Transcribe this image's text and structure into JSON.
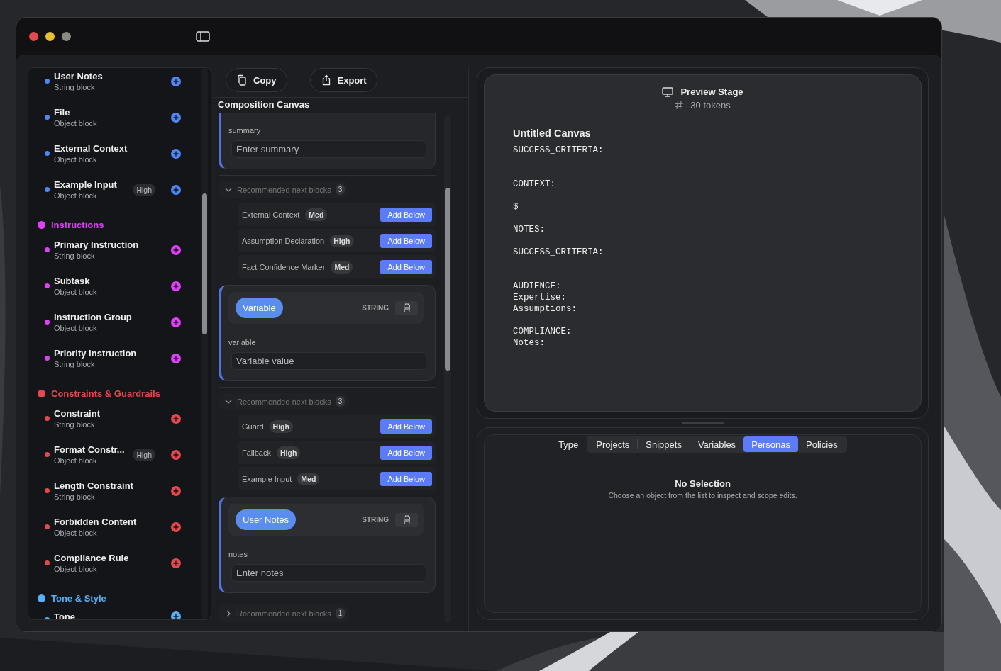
{
  "sidebar": {
    "groups": [
      {
        "color": "#4f86f7",
        "items": [
          {
            "name": "User Notes",
            "type": "String block"
          },
          {
            "name": "File",
            "type": "Object block"
          },
          {
            "name": "External Context",
            "type": "Object block"
          },
          {
            "name": "Example Input",
            "type": "Object block",
            "badge": "High"
          }
        ]
      },
      {
        "title": "Instructions",
        "color": "#e040fb",
        "items": [
          {
            "name": "Primary Instruction",
            "type": "String block"
          },
          {
            "name": "Subtask",
            "type": "Object block"
          },
          {
            "name": "Instruction Group",
            "type": "Object block"
          },
          {
            "name": "Priority Instruction",
            "type": "String block"
          }
        ]
      },
      {
        "title": "Constraints & Guardrails",
        "color": "#e5484d",
        "items": [
          {
            "name": "Constraint",
            "type": "String block"
          },
          {
            "name": "Format Constr...",
            "type": "Object block",
            "badge": "High"
          },
          {
            "name": "Length Constraint",
            "type": "String block"
          },
          {
            "name": "Forbidden Content",
            "type": "Object block"
          },
          {
            "name": "Compliance Rule",
            "type": "Object block"
          }
        ]
      },
      {
        "title": "Tone & Style",
        "color": "#5ab0f5",
        "items": [
          {
            "name": "Tone"
          }
        ]
      }
    ]
  },
  "toolbar": {
    "buttons": [
      {
        "label": "Copy",
        "kind": "copy"
      },
      {
        "label": "Export",
        "kind": "export"
      }
    ]
  },
  "canvas": {
    "title": "Composition Canvas",
    "entries": [
      {
        "kind": "block",
        "label": "summary",
        "placeholder": "Enter summary"
      },
      {
        "kind": "recommendations",
        "title": "Recommended next blocks",
        "count": "3",
        "expanded": true,
        "items": [
          {
            "name": "External Context",
            "priority": "Med",
            "action": "Add Below"
          },
          {
            "name": "Assumption Declaration",
            "priority": "High",
            "action": "Add Below"
          },
          {
            "name": "Fact Confidence Marker",
            "priority": "Med",
            "action": "Add Below"
          }
        ]
      },
      {
        "kind": "block",
        "chip": "Variable",
        "type": "STRING",
        "label": "variable",
        "placeholder": "Variable value"
      },
      {
        "kind": "recommendations",
        "title": "Recommended next blocks",
        "count": "3",
        "expanded": true,
        "items": [
          {
            "name": "Guard",
            "priority": "High",
            "action": "Add Below"
          },
          {
            "name": "Fallback",
            "priority": "High",
            "action": "Add Below"
          },
          {
            "name": "Example Input",
            "priority": "Med",
            "action": "Add Below"
          }
        ]
      },
      {
        "kind": "block",
        "chip": "User Notes",
        "type": "STRING",
        "label": "notes",
        "placeholder": "Enter notes"
      },
      {
        "kind": "recommendations",
        "title": "Recommended next blocks",
        "count": "1",
        "expanded": false
      }
    ]
  },
  "preview": {
    "title": "Preview Stage",
    "tokens": "30 tokens",
    "canvas_title": "Untitled Canvas",
    "text": "SUCCESS_CRITERIA:\n\n\nCONTEXT:\n\n$\n\nNOTES:\n\nSUCCESS_CRITERIA:\n\n\nAUDIENCE:\nExpertise:\nAssumptions:\n\nCOMPLIANCE:\nNotes:"
  },
  "inspector": {
    "type_label": "Type",
    "tabs": [
      {
        "label": "Projects",
        "selected": false
      },
      {
        "label": "Snippets",
        "selected": false
      },
      {
        "label": "Variables",
        "selected": false
      },
      {
        "label": "Personas",
        "selected": true
      },
      {
        "label": "Policies",
        "selected": false
      }
    ],
    "empty_title": "No Selection",
    "empty_text": "Choose an object from the list to inspect and scope edits."
  }
}
